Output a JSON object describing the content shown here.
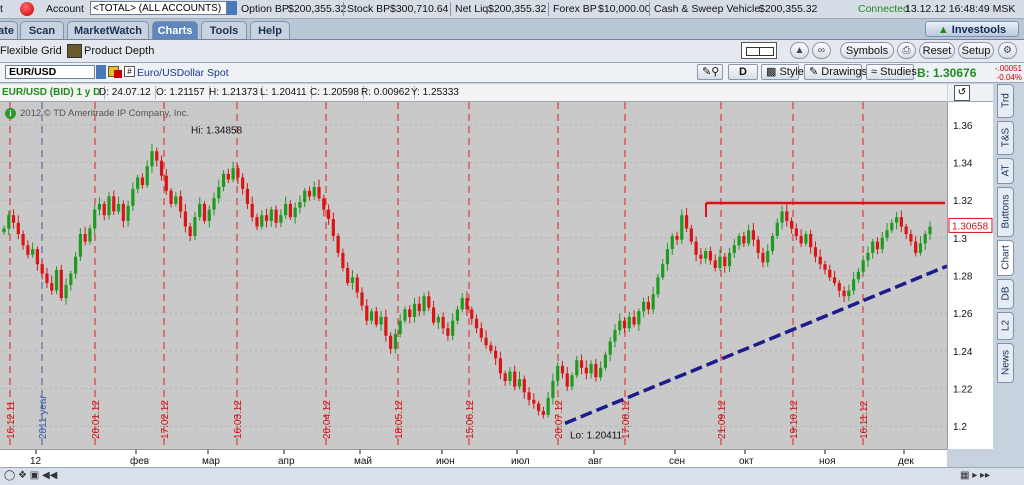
{
  "account_bar": {
    "account_label": "Account",
    "account_value": "<TOTAL> (ALL ACCOUNTS)",
    "option_bp_label": "Option BP",
    "option_bp_value": "$200,355.32",
    "stock_bp_label": "Stock BP",
    "stock_bp_value": "$300,710.64",
    "net_liq_label": "Net Liq",
    "net_liq_value": "$200,355.32",
    "forex_bp_label": "Forex BP",
    "forex_bp_value": "$10,000.00",
    "cash_label": "Cash & Sweep Vehicle",
    "cash_value": "$200,355.32",
    "status": "Connected",
    "time": "13.12.12 16:48:49 MSK"
  },
  "tabs": [
    {
      "label": "ate"
    },
    {
      "label": "Scan"
    },
    {
      "label": "MarketWatch"
    },
    {
      "label": "Charts"
    },
    {
      "label": "Tools"
    },
    {
      "label": "Help"
    }
  ],
  "investools_label": "Investools",
  "toolbar": {
    "flexible_grid": "Flexible Grid",
    "product_depth": "Product Depth",
    "symbols": "Symbols",
    "reset": "Reset",
    "setup": "Setup"
  },
  "symbol_row": {
    "symbol": "EUR/USD",
    "description": "Euro/USDollar Spot",
    "hash": "#",
    "period": "D",
    "style": "Style",
    "drawings": "Drawings",
    "studies": "Studies",
    "bid": "B: 1.30676",
    "change_abs": "-.00051",
    "change_pct": "-0.04%"
  },
  "info_row": {
    "title": "EUR/USD (BID) 1 y D",
    "date": "D: 24.07.12",
    "open": "O: 1.21157",
    "high": "H: 1.21373",
    "low": "L: 1.20411",
    "close": "C: 1.20598",
    "range": "R: 0.00962",
    "y": "Y: 1.25333"
  },
  "copyright": "2012 © TD Ameritrade IP Company, Inc.",
  "side_tabs": [
    "Trd",
    "T&S",
    "AT",
    "Buttons",
    "Chart",
    "DB",
    "L2",
    "News"
  ],
  "colors": {
    "candle_up": "#1f9a1f",
    "candle_down": "#d91515",
    "resistance": "#e01010",
    "trend": "#1c1c8c",
    "chart_bg": "#c9c9c9",
    "bid_green": "#1f8a1f"
  },
  "chart_data": {
    "type": "candlestick",
    "symbol": "EUR/USD (BID)",
    "ylim": [
      1.19,
      1.37
    ],
    "y_ticks": [
      "1.36",
      "1.34",
      "1.32",
      "1.3",
      "1.28",
      "1.26",
      "1.24",
      "1.22",
      "1.2"
    ],
    "x_month_labels": [
      "12",
      "фев",
      "мар",
      "апр",
      "май",
      "июн",
      "июл",
      "авг",
      "сен",
      "окт",
      "ноя",
      "дек"
    ],
    "vertical_markers": [
      "16.12.11",
      "2011 year",
      "20.01.12",
      "17.02.12",
      "16.03.12",
      "20.04.12",
      "18.05.12",
      "15.06.12",
      "20.07.12",
      "17.08.12",
      "21.09.12",
      "19.10.12",
      "16.11.12"
    ],
    "hi_label": "Hi: 1.34858",
    "lo_label": "Lo: 1.20411",
    "last_price_label": "1.30658",
    "resistance_level": 1.3185,
    "trendline": {
      "start": 1.2015,
      "end": 1.285
    },
    "closes": [
      1.305,
      1.312,
      1.308,
      1.302,
      1.296,
      1.291,
      1.294,
      1.286,
      1.281,
      1.276,
      1.272,
      1.283,
      1.268,
      1.275,
      1.281,
      1.29,
      1.302,
      1.298,
      1.305,
      1.315,
      1.318,
      1.312,
      1.322,
      1.314,
      1.318,
      1.309,
      1.317,
      1.326,
      1.332,
      1.328,
      1.338,
      1.346,
      1.341,
      1.333,
      1.325,
      1.318,
      1.322,
      1.314,
      1.306,
      1.301,
      1.311,
      1.318,
      1.309,
      1.315,
      1.321,
      1.327,
      1.334,
      1.331,
      1.337,
      1.332,
      1.326,
      1.318,
      1.311,
      1.306,
      1.312,
      1.309,
      1.315,
      1.308,
      1.312,
      1.318,
      1.311,
      1.316,
      1.319,
      1.325,
      1.322,
      1.327,
      1.321,
      1.315,
      1.31,
      1.301,
      1.292,
      1.284,
      1.276,
      1.279,
      1.271,
      1.264,
      1.256,
      1.261,
      1.254,
      1.258,
      1.248,
      1.241,
      1.249,
      1.256,
      1.262,
      1.258,
      1.265,
      1.261,
      1.269,
      1.263,
      1.255,
      1.258,
      1.252,
      1.248,
      1.256,
      1.262,
      1.268,
      1.262,
      1.257,
      1.252,
      1.247,
      1.243,
      1.24,
      1.236,
      1.228,
      1.224,
      1.229,
      1.221,
      1.225,
      1.218,
      1.214,
      1.212,
      1.208,
      1.206,
      1.215,
      1.224,
      1.232,
      1.228,
      1.221,
      1.227,
      1.235,
      1.231,
      1.228,
      1.233,
      1.226,
      1.231,
      1.238,
      1.245,
      1.251,
      1.256,
      1.252,
      1.258,
      1.254,
      1.261,
      1.266,
      1.262,
      1.27,
      1.279,
      1.286,
      1.294,
      1.301,
      1.299,
      1.312,
      1.305,
      1.298,
      1.291,
      1.289,
      1.293,
      1.288,
      1.284,
      1.29,
      1.285,
      1.292,
      1.296,
      1.301,
      1.297,
      1.304,
      1.299,
      1.292,
      1.287,
      1.293,
      1.301,
      1.308,
      1.314,
      1.309,
      1.305,
      1.301,
      1.297,
      1.302,
      1.295,
      1.29,
      1.286,
      1.283,
      1.279,
      1.276,
      1.272,
      1.269,
      1.272,
      1.278,
      1.282,
      1.288,
      1.292,
      1.298,
      1.294,
      1.3,
      1.304,
      1.308,
      1.311,
      1.306,
      1.302,
      1.298,
      1.292,
      1.297,
      1.302,
      1.306
    ]
  }
}
